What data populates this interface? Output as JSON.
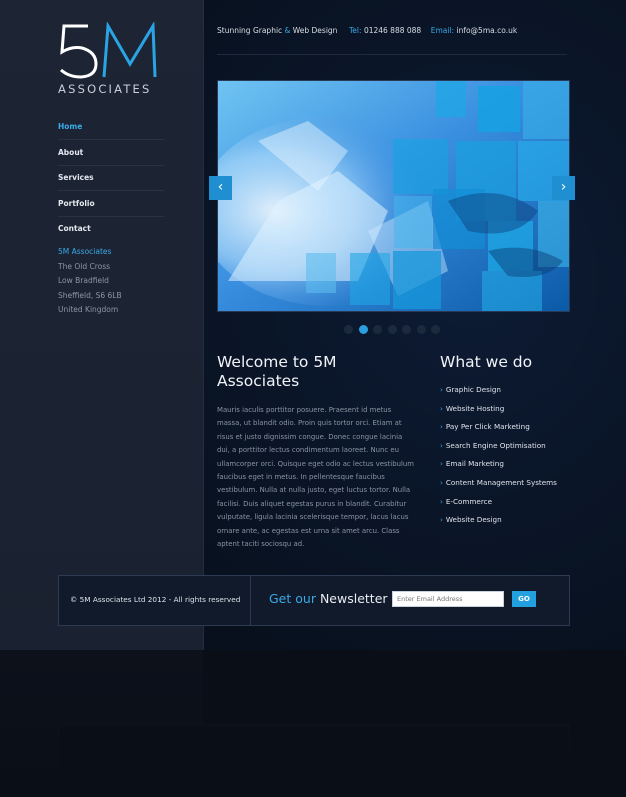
{
  "brand": {
    "logo_mark": "5M",
    "logo_text": "ASSOCIATES"
  },
  "nav": {
    "items": [
      {
        "label": "Home",
        "active": true
      },
      {
        "label": "About",
        "active": false
      },
      {
        "label": "Services",
        "active": false
      },
      {
        "label": "Portfolio",
        "active": false
      },
      {
        "label": "Contact",
        "active": false
      }
    ]
  },
  "address": {
    "org": "5M Associates",
    "lines": [
      "The Old Cross",
      "Low Bradfield",
      "Sheffield, S6 6LB",
      "United Kingdom"
    ]
  },
  "header": {
    "tagline_part1": "Stunning Graphic",
    "tagline_amp": "&",
    "tagline_part2": "Web Design",
    "tel_label": "Tel:",
    "tel_value": "01246 888 088",
    "email_label": "Email:",
    "email_value": "info@5ma.co.uk"
  },
  "slider": {
    "prev_icon": "chevron-left-icon",
    "next_icon": "chevron-right-icon",
    "prev_glyph": "‹",
    "next_glyph": "›",
    "dot_count": 7,
    "active_dot": 1
  },
  "welcome": {
    "title": "Welcome to 5M Associates",
    "body": "Mauris iaculis porttitor posuere. Praesent id metus massa, ut blandit odio. Proin quis tortor orci. Etiam at risus et justo dignissim congue. Donec congue lacinia dui, a porttitor lectus condimentum laoreet. Nunc eu ullamcorper orci. Quisque eget odio ac lectus vestibulum faucibus eget in metus. In pellentesque faucibus vestibulum. Nulla at nulla justo, eget luctus tortor. Nulla facilisi. Duis aliquet egestas purus in blandit. Curabitur vulputate, ligula lacinia scelerisque tempor, lacus lacus ornare ante, ac egestas est urna sit amet arcu. Class aptent taciti sociosqu ad."
  },
  "what_we_do": {
    "title": "What we do",
    "chevron_glyph": "›",
    "services": [
      "Graphic Design",
      "Website Hosting",
      "Pay Per Click Marketing",
      "Search Engine Optimisation",
      "Email Marketing",
      "Content Management Systems",
      "E-Commerce",
      "Website Design"
    ]
  },
  "footer": {
    "copyright": "© 5M Associates Ltd 2012 - All rights reserved",
    "newsletter_get": "Get our",
    "newsletter_word": "Newsletter",
    "email_placeholder": "Enter Email Address",
    "go_label": "GO"
  },
  "colors": {
    "accent": "#3aa9e6",
    "sidebar_bg": "#1d2535",
    "page_bg": "#08111f"
  }
}
